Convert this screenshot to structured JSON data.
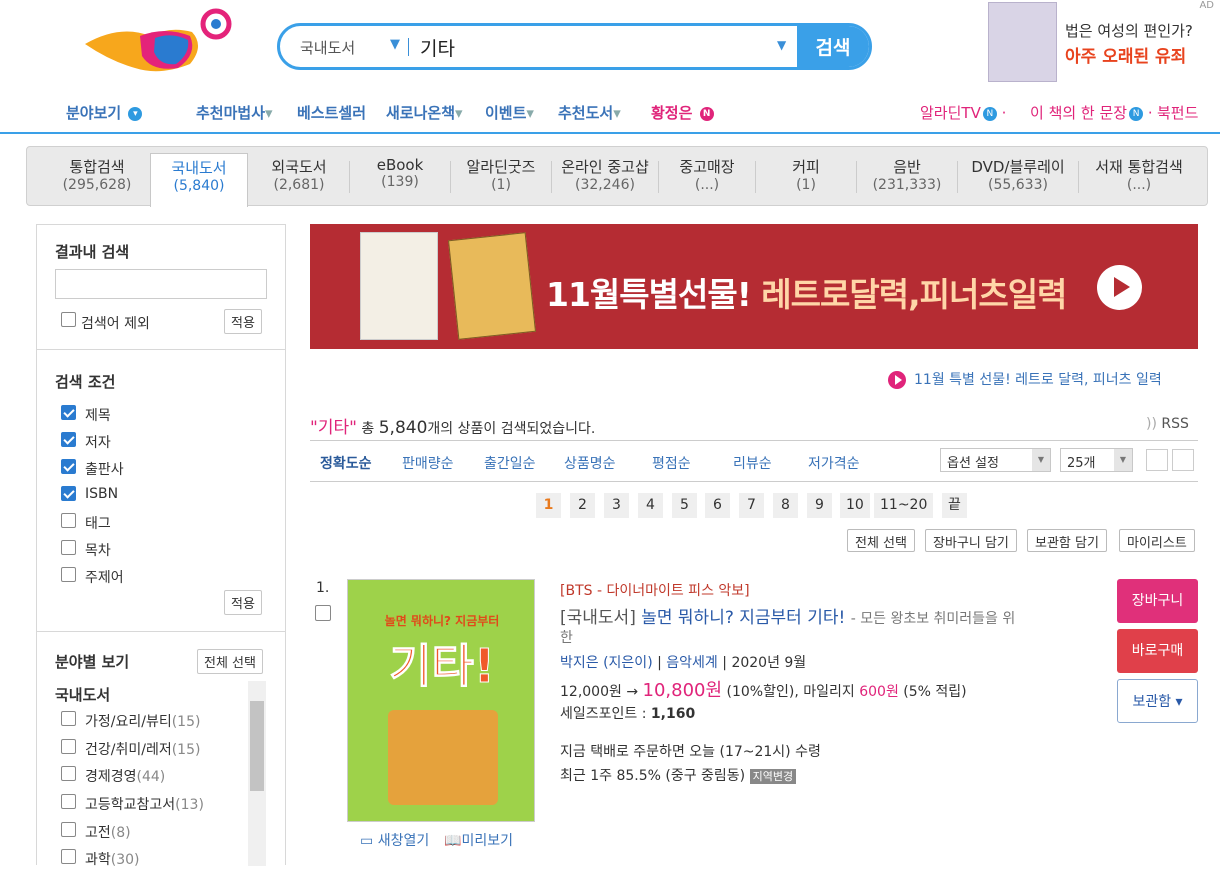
{
  "search": {
    "category": "국내도서",
    "query": "기타",
    "button": "검색"
  },
  "ad": {
    "label": "AD",
    "line1": "법은 여성의 편인가?",
    "line2": "아주 오래된 유죄"
  },
  "nav": {
    "items": [
      "분야보기",
      "추천마법사",
      "베스트셀러",
      "새로나온책",
      "이벤트",
      "추천도서",
      "황정은"
    ],
    "right": [
      "알라딘TV",
      "이 책의 한 문장",
      "북펀드"
    ]
  },
  "tabs": [
    {
      "name": "통합검색",
      "count": "(295,628)"
    },
    {
      "name": "국내도서",
      "count": "(5,840)"
    },
    {
      "name": "외국도서",
      "count": "(2,681)"
    },
    {
      "name": "eBook",
      "count": "(139)"
    },
    {
      "name": "알라딘굿즈",
      "count": "(1)"
    },
    {
      "name": "온라인 중고샵",
      "count": "(32,246)"
    },
    {
      "name": "중고매장",
      "count": "(...)"
    },
    {
      "name": "커피",
      "count": "(1)"
    },
    {
      "name": "음반",
      "count": "(231,333)"
    },
    {
      "name": "DVD/블루레이",
      "count": "(55,633)"
    },
    {
      "name": "서재 통합검색",
      "count": "(...)"
    }
  ],
  "sidebar": {
    "within_title": "결과내 검색",
    "exclude_label": "검색어 제외",
    "apply": "적용",
    "cond_title": "검색 조건",
    "conditions": [
      {
        "label": "제목",
        "checked": true
      },
      {
        "label": "저자",
        "checked": true
      },
      {
        "label": "출판사",
        "checked": true
      },
      {
        "label": "ISBN",
        "checked": true
      },
      {
        "label": "태그",
        "checked": false
      },
      {
        "label": "목차",
        "checked": false
      },
      {
        "label": "주제어",
        "checked": false
      }
    ],
    "category_title": "분야별 보기",
    "select_all": "전체 선택",
    "category_group": "국내도서",
    "categories": [
      {
        "label": "가정/요리/뷰티",
        "count": "(15)"
      },
      {
        "label": "건강/취미/레저",
        "count": "(15)"
      },
      {
        "label": "경제경영",
        "count": "(44)"
      },
      {
        "label": "고등학교참고서",
        "count": "(13)"
      },
      {
        "label": "고전",
        "count": "(8)"
      },
      {
        "label": "과학",
        "count": "(30)"
      }
    ]
  },
  "banner": {
    "text_white": "11월특별선물!",
    "text_yellow": "레트로달력,피너츠일력",
    "link": "11월 특별 선물! 레트로 달력, 피너츠 일력"
  },
  "summary": {
    "keyword": "\"기타\"",
    "prefix": "총",
    "count": "5,840",
    "suffix": "개의 상품이 검색되었습니다.",
    "rss": "RSS"
  },
  "sort": {
    "options": [
      "정확도순",
      "판매량순",
      "출간일순",
      "상품명순",
      "평점순",
      "리뷰순",
      "저가격순"
    ],
    "option_select": "옵션 설정",
    "per_page": "25개"
  },
  "pagination": [
    "1",
    "2",
    "3",
    "4",
    "5",
    "6",
    "7",
    "8",
    "9",
    "10",
    "11~20",
    "끝"
  ],
  "actions": [
    "전체 선택",
    "장바구니 담기",
    "보관함 담기",
    "마이리스트"
  ],
  "item": {
    "index": "1.",
    "series": "[BTS - 다이너마이트 피스 악보]",
    "prefix": "[국내도서]",
    "title": "놀면 뭐하니? 지금부터 기타!",
    "subtitle_1": "- 모든 왕초보 취미러들을 위",
    "subtitle_2": "한",
    "author": "박지은 (지은이)",
    "publisher": "음악세계",
    "date": "2020년 9월",
    "price_orig": "12,000원",
    "price_sale": "10,800원",
    "discount": "(10%할인),",
    "mileage_label": "마일리지",
    "mileage": "600원",
    "mileage_rate": "(5% 적립)",
    "sales_point_label": "세일즈포인트 :",
    "sales_point": "1,160",
    "delivery": "지금 택배로 주문하면 오늘 (17~21시) 수령",
    "stat": "최근 1주 85.5% (중구 중림동)",
    "region_change": "지역변경",
    "new_window": "새창열기",
    "preview": "미리보기",
    "cover_top": "놀면 뭐하니? 지금부터",
    "cover_big": "기타!",
    "btn_cart": "장바구니",
    "btn_buy": "바로구매",
    "btn_save": "보관함"
  }
}
